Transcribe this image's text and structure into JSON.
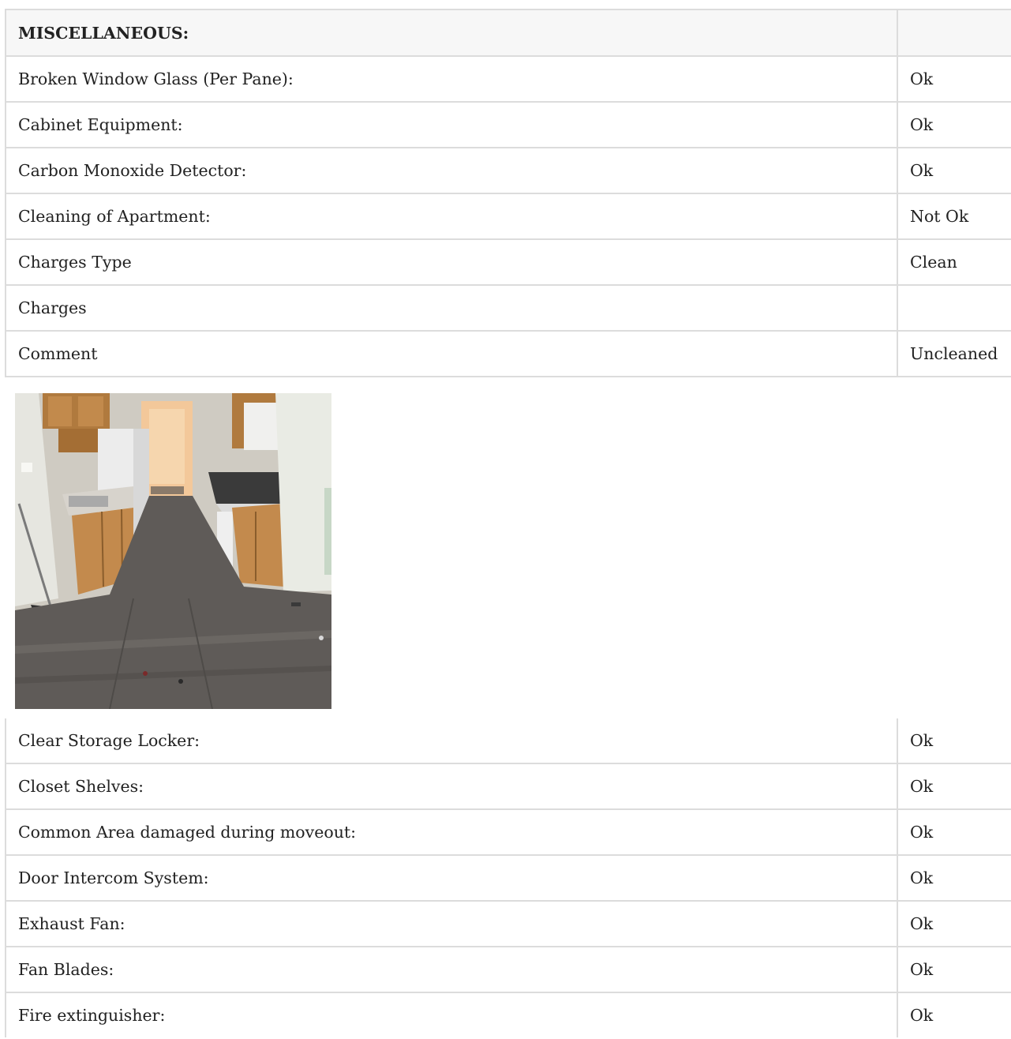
{
  "section": {
    "title": "MISCELLANEOUS:"
  },
  "rows_top": [
    {
      "label": "Broken Window Glass (Per Pane):",
      "value": "Ok"
    },
    {
      "label": "Cabinet Equipment:",
      "value": "Ok"
    },
    {
      "label": "Carbon Monoxide Detector:",
      "value": "Ok"
    },
    {
      "label": "Cleaning of Apartment:",
      "value": "Not Ok"
    },
    {
      "label": "Charges Type",
      "value": "Clean"
    },
    {
      "label": "Charges",
      "value": ""
    },
    {
      "label": "Comment",
      "value": "Uncleaned"
    }
  ],
  "rows_bottom": [
    {
      "label": "Clear Storage Locker:",
      "value": "Ok"
    },
    {
      "label": "Closet Shelves:",
      "value": "Ok"
    },
    {
      "label": "Common Area damaged during moveout:",
      "value": "Ok"
    },
    {
      "label": "Door Intercom System:",
      "value": "Ok"
    },
    {
      "label": "Exhaust Fan:",
      "value": "Ok"
    },
    {
      "label": "Fan Blades:",
      "value": "Ok"
    },
    {
      "label": "Fire extinguisher:",
      "value": "Ok"
    }
  ],
  "colors": {
    "border": "#dcdcdc",
    "header_bg": "#f7f7f7",
    "text": "#222222"
  }
}
